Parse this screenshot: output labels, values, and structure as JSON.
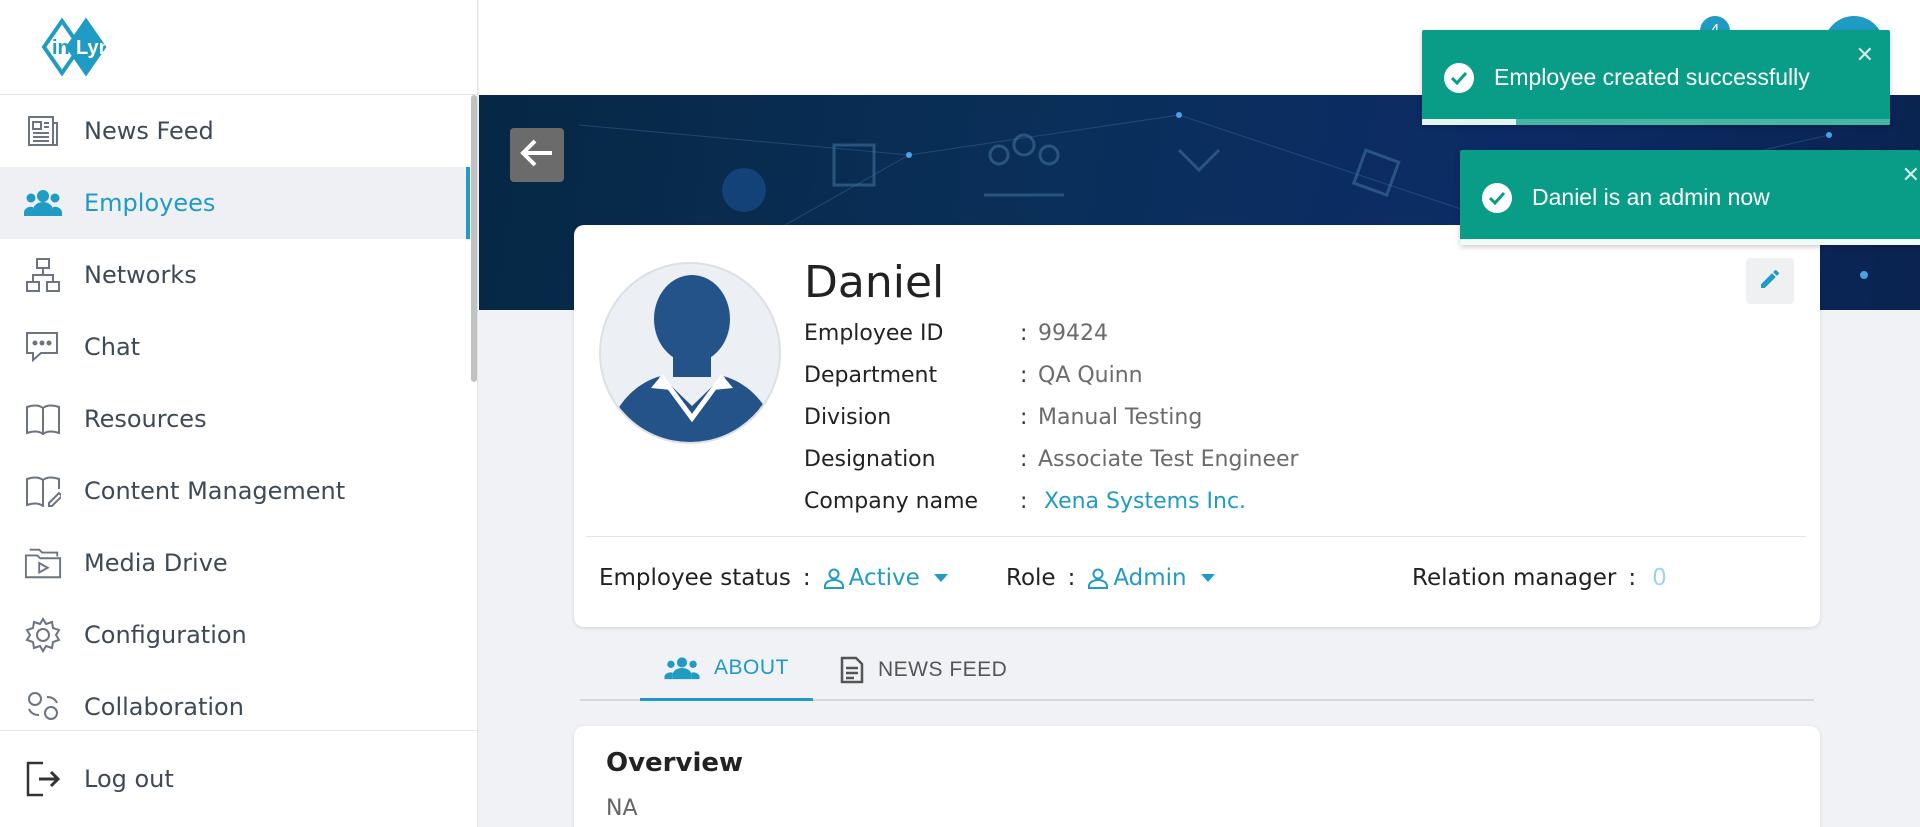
{
  "app": {
    "logo_text": "inLynk",
    "notification_count": "4"
  },
  "sidebar": {
    "items": [
      {
        "label": "News Feed",
        "icon": "news-feed-icon"
      },
      {
        "label": "Employees",
        "icon": "employees-icon",
        "active": true
      },
      {
        "label": "Networks",
        "icon": "networks-icon"
      },
      {
        "label": "Chat",
        "icon": "chat-icon"
      },
      {
        "label": "Resources",
        "icon": "book-icon"
      },
      {
        "label": "Content Management",
        "icon": "content-management-icon"
      },
      {
        "label": "Media Drive",
        "icon": "media-drive-icon"
      },
      {
        "label": "Configuration",
        "icon": "gear-icon"
      },
      {
        "label": "Collaboration",
        "icon": "collaboration-icon"
      }
    ],
    "logout_label": "Log out"
  },
  "profile": {
    "name": "Daniel",
    "fields": [
      {
        "key": "Employee ID",
        "value": "99424"
      },
      {
        "key": "Department",
        "value": "QA Quinn"
      },
      {
        "key": "Division",
        "value": "Manual Testing"
      },
      {
        "key": "Designation",
        "value": "Associate Test Engineer"
      },
      {
        "key": "Company name",
        "value": "Xena Systems Inc."
      }
    ],
    "separator": ":",
    "status_label": "Employee status",
    "status_value": "Active",
    "role_label": "Role",
    "role_value": "Admin",
    "relation_manager_label": "Relation manager",
    "relation_manager_value": "0"
  },
  "tabs": [
    {
      "label": "ABOUT",
      "active": true
    },
    {
      "label": "NEWS FEED",
      "active": false
    }
  ],
  "overview": {
    "title": "Overview",
    "text": "NA"
  },
  "toasts": [
    {
      "message": "Employee created successfully",
      "progress": 0.2
    },
    {
      "message": "Daniel is an admin now"
    }
  ],
  "colors": {
    "accent": "#1f9bc4",
    "toast_bg": "#099c86",
    "banner_bg": "#0a2f5a"
  }
}
